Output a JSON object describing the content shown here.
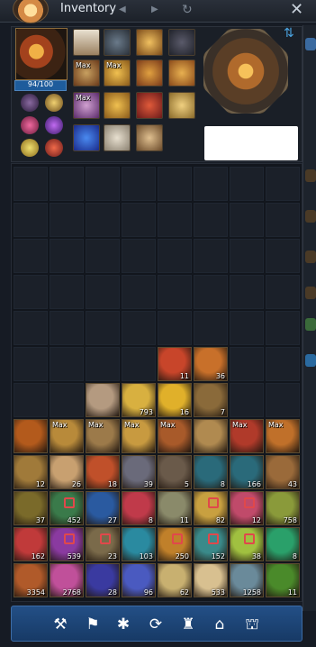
{
  "window": {
    "title": "Inventory",
    "prev_arrow": "◀",
    "next_arrow": "▶",
    "refresh_icon": "↻",
    "close_icon": "✕"
  },
  "equipment": {
    "hp_text": "94/100",
    "swap_icon": "⇅",
    "max_labels": [
      "Max",
      "Max",
      "Max"
    ]
  },
  "inventory": {
    "rows": [
      [
        {},
        {},
        {},
        {},
        {},
        {},
        {},
        {}
      ],
      [
        {},
        {},
        {},
        {},
        {},
        {},
        {},
        {}
      ],
      [
        {},
        {},
        {},
        {},
        {},
        {},
        {},
        {}
      ],
      [
        {},
        {},
        {},
        {},
        {},
        {},
        {},
        {}
      ],
      [
        {},
        {},
        {},
        {},
        {},
        {},
        {},
        {}
      ],
      [
        {},
        {},
        {},
        {},
        {
          "color": "#c8452a",
          "count": "11"
        },
        {
          "color": "#c8702a",
          "count": "36"
        },
        {},
        {}
      ],
      [
        {},
        {},
        {
          "color": "#b49a80"
        },
        {
          "color": "#d8b040",
          "count": "793"
        },
        {
          "color": "#e0b02a",
          "count": "16"
        },
        {
          "color": "#8a6a3a",
          "count": "7"
        },
        {},
        {}
      ],
      [
        {
          "color": "#b35a1c"
        },
        {
          "color": "#b88a3a",
          "max": "Max"
        },
        {
          "color": "#9c7a4a",
          "max": "Max"
        },
        {
          "color": "#c89a40",
          "max": "Max"
        },
        {
          "color": "#a85a2a",
          "max": "Max"
        },
        {
          "color": "#b08a50"
        },
        {
          "color": "#b03a2a",
          "max": "Max"
        },
        {
          "color": "#c0702a",
          "max": "Max"
        }
      ],
      [
        {
          "color": "#a07a3a",
          "count": "12"
        },
        {
          "color": "#c8a070",
          "count": "26"
        },
        {
          "color": "#c0502a",
          "count": "18"
        },
        {
          "color": "#6a6a7a",
          "count": "39"
        },
        {
          "color": "#6a5a4a",
          "count": "5"
        },
        {
          "color": "#2a6a7a",
          "count": "8"
        },
        {
          "color": "#2a6a7a",
          "count": "166"
        },
        {
          "color": "#9a6a3a",
          "count": "43"
        }
      ],
      [
        {
          "color": "#7a6a2a",
          "count": "37"
        },
        {
          "color": "#3a7a4a",
          "count": "452",
          "bound": true
        },
        {
          "color": "#2a5aa0",
          "count": "27"
        },
        {
          "color": "#c03a4a",
          "count": "8"
        },
        {
          "color": "#8a8a6a",
          "count": "11"
        },
        {
          "color": "#c8a040",
          "count": "82",
          "bound": true
        },
        {
          "color": "#c04a6a",
          "count": "12",
          "bound": true
        },
        {
          "color": "#8a9a3a",
          "count": "758"
        }
      ],
      [
        {
          "color": "#c03a3a",
          "count": "162"
        },
        {
          "color": "#8a3aa0",
          "count": "539",
          "bound": true
        },
        {
          "color": "#7a6a4a",
          "count": "23",
          "bound": true
        },
        {
          "color": "#2a8aa0",
          "count": "103"
        },
        {
          "color": "#c0802a",
          "count": "250",
          "bound": true
        },
        {
          "color": "#3a8a8a",
          "count": "152",
          "bound": true
        },
        {
          "color": "#a0c040",
          "count": "38",
          "bound": true
        },
        {
          "color": "#2aa06a",
          "count": "8"
        }
      ],
      [
        {
          "color": "#b05a2a",
          "count": "3354"
        },
        {
          "color": "#c0509a",
          "count": "2768"
        },
        {
          "color": "#3a3aa0",
          "count": "28"
        },
        {
          "color": "#4a5ac0",
          "count": "96"
        },
        {
          "color": "#c8b070",
          "count": "62"
        },
        {
          "color": "#d8c090",
          "count": "533"
        },
        {
          "color": "#6a8a9a",
          "count": "1258"
        },
        {
          "color": "#4a8a2a",
          "count": "11"
        }
      ]
    ]
  },
  "toolbar": {
    "buttons": [
      {
        "name": "craft-button",
        "icon": "⚒"
      },
      {
        "name": "map-button",
        "icon": "⚑"
      },
      {
        "name": "sparkle-button",
        "icon": "✱"
      },
      {
        "name": "cycle-button",
        "icon": "⟳"
      },
      {
        "name": "guild-button",
        "icon": "♜"
      },
      {
        "name": "shop-button",
        "icon": "⌂"
      },
      {
        "name": "warehouse-button",
        "icon": "⛫"
      }
    ]
  }
}
